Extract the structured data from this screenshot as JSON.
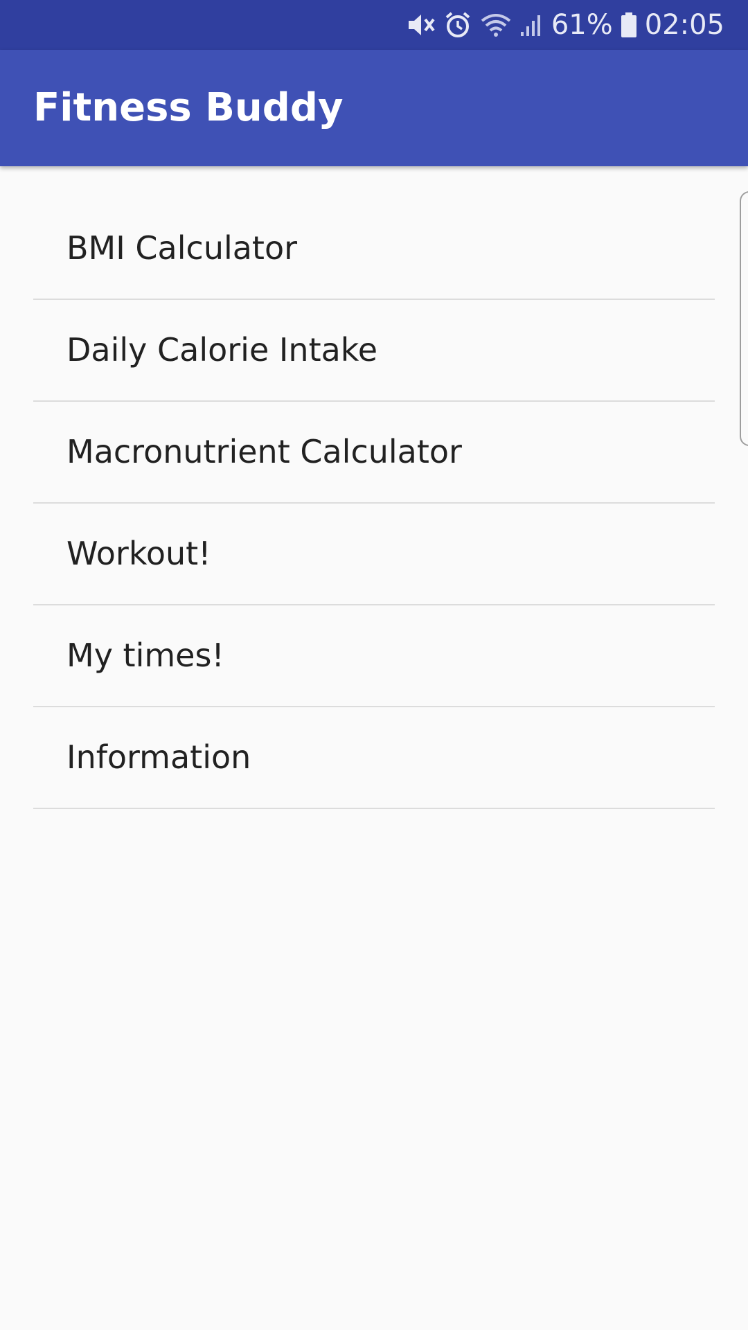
{
  "status_bar": {
    "battery_percent": "61%",
    "time": "02:05",
    "icons": [
      "mute-icon",
      "alarm-icon",
      "wifi-icon",
      "signal-icon",
      "battery-icon"
    ]
  },
  "app_bar": {
    "title": "Fitness Buddy"
  },
  "menu": {
    "items": [
      {
        "label": "BMI Calculator"
      },
      {
        "label": "Daily Calorie Intake"
      },
      {
        "label": "Macronutrient Calculator"
      },
      {
        "label": "Workout!"
      },
      {
        "label": "My times!"
      },
      {
        "label": "Information"
      }
    ]
  },
  "colors": {
    "status_bar": "#303f9f",
    "app_bar": "#3f51b5",
    "background": "#fafafa",
    "text": "#212121",
    "divider": "#dcdcdc"
  }
}
